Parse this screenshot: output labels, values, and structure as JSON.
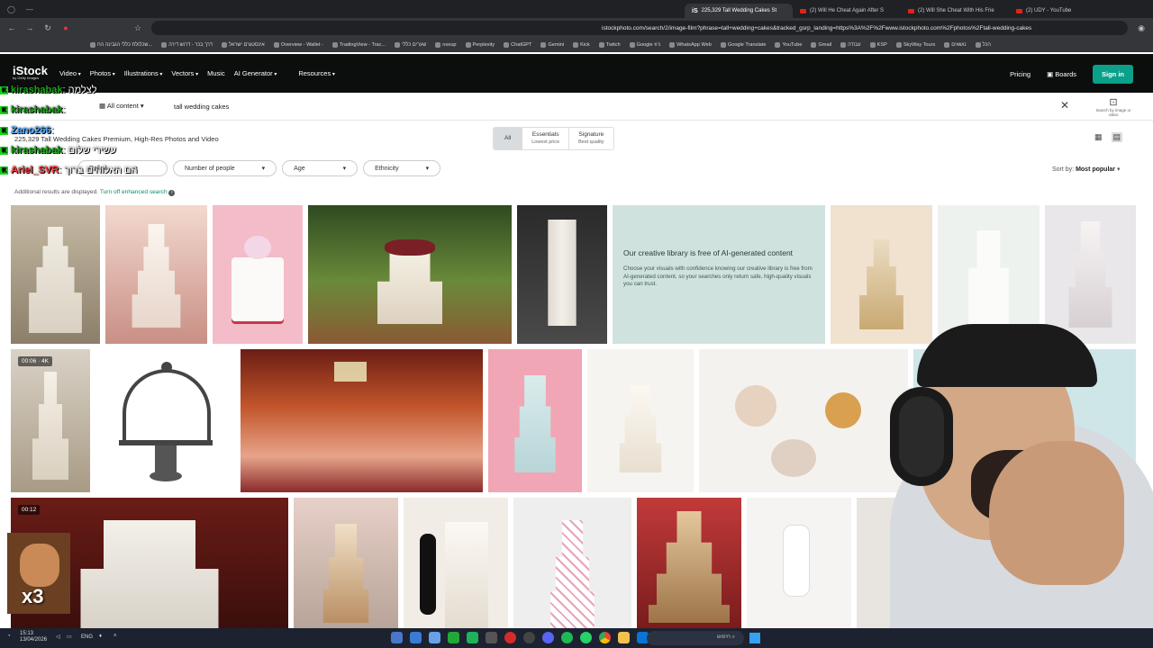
{
  "browser": {
    "tabs": [
      {
        "label": "225,329 Tall Wedding Cakes St",
        "active": true,
        "favicon": "iS"
      },
      {
        "label": "(2) Will He Cheat Again After S",
        "active": false
      },
      {
        "label": "(2) Will She Cheat With His Frie",
        "active": false
      },
      {
        "label": "(2) UDY - YouTube",
        "active": false
      }
    ],
    "url": "istockphoto.com/search/2/image-film?phrase=tall+wedding+cakes&tracked_gsrp_landing=https%3A%2F%2Fwww.istockphoto.com%2Fphotos%2Ftall-wedding-cakes",
    "bookmarks": [
      "הכל",
      "נושאים",
      "SkyWay Tours",
      "KSP",
      "עבודה",
      "Gmail",
      "YouTube",
      "Google Translate",
      "WhatsApp Web",
      "Google ניוז",
      "Twitch",
      "Kick",
      "Gemini",
      "ChatGPT",
      "Perplexity",
      "nseup",
      "שערים כללי",
      "TradingView - Trac...",
      "Overview - Wallet -",
      "אינסטגרם ישראל",
      "דרך בכר - דרוש דירה",
      "שכלולת כללי הגבינה הח..."
    ]
  },
  "nav": {
    "logo": "iStock",
    "logo_sub": "by Getty Images",
    "items": [
      "Video",
      "Photos",
      "Illustrations",
      "Vectors",
      "Music",
      "AI Generator",
      "Resources"
    ],
    "pricing": "Pricing",
    "boards": "Boards",
    "signin": "Sign in"
  },
  "search": {
    "content_type": "All content",
    "query": "tall wedding cakes",
    "image_search_label": "Search by image or video"
  },
  "results": {
    "count_text": "225,329 Tall Wedding Cakes Premium, High-Res Photos and Video",
    "segments": [
      {
        "label": "All",
        "sub": ""
      },
      {
        "label": "Essentials",
        "sub": "Lowest price"
      },
      {
        "label": "Signature",
        "sub": "Best quality"
      }
    ],
    "filters": [
      "Refine",
      "Number of people",
      "Age",
      "Ethnicity"
    ],
    "sort_label": "Sort by:",
    "sort_value": "Most popular",
    "enhanced_note": "Additional results are displayed.",
    "enhanced_link": "Turn off enhanced search"
  },
  "ai_panel": {
    "title": "Our creative library is free of AI-generated content",
    "body": "Choose your visuals with confidence knowing our creative library is free from AI-generated content, so your searches only return safe, high-quality visuals you can trust."
  },
  "badges": {
    "video1": "00:06 · 4K",
    "video2": "00:12"
  },
  "chat": [
    {
      "user": "kirashabak",
      "msg": ": לצלמה",
      "color": "#1aa31a"
    },
    {
      "user": "kirashabak",
      "msg": ": ",
      "color": "#1aa31a"
    },
    {
      "user": "Zano266",
      "msg": ": ",
      "color": "#4aa6ff"
    },
    {
      "user": "kirashabak",
      "msg": ": עשירי שלום",
      "color": "#1aa31a"
    },
    {
      "user": "Ariel_SVR",
      "msg": ": הם האלוהים ברוך",
      "color": "#ff4040"
    }
  ],
  "emote_text": "x3",
  "taskbar": {
    "time": "15:13",
    "date": "13/04/2026",
    "lang": "ENG",
    "search": "חיפוש"
  }
}
